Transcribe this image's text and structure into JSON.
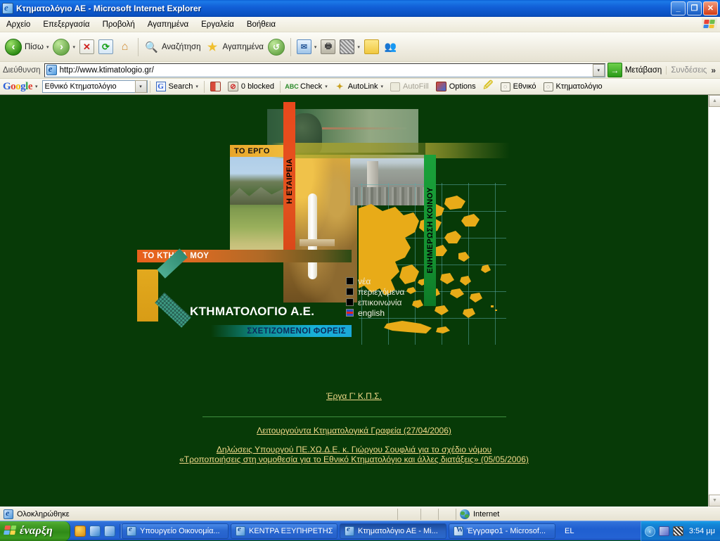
{
  "window": {
    "title": "Κτηματολόγιο ΑΕ - Microsoft Internet Explorer",
    "minimize_label": "_",
    "maximize_label": "❐",
    "close_label": "✕"
  },
  "menu": {
    "items": [
      {
        "label": "Αρχείο"
      },
      {
        "label": "Επεξεργασία"
      },
      {
        "label": "Προβολή"
      },
      {
        "label": "Αγαπημένα"
      },
      {
        "label": "Εργαλεία"
      },
      {
        "label": "Βοήθεια"
      }
    ]
  },
  "toolbar": {
    "back_label": "Πίσω",
    "forward_label": "",
    "stop_label": "",
    "refresh_label": "",
    "home_label": "",
    "search_label": "Αναζήτηση",
    "favorites_label": "Αγαπημένα",
    "history_label": "",
    "mail_label": "",
    "print_label": "",
    "edit_label": "",
    "notes_label": "",
    "messenger_label": "",
    "caret": "▾"
  },
  "address": {
    "label": "Διεύθυνση",
    "url": "http://www.ktimatologio.gr/",
    "go_label": "Μετάβαση",
    "links_label": "Συνδέσεις",
    "chevron": "»",
    "dropdown_caret": "▾"
  },
  "google_toolbar": {
    "logo": {
      "g1": "G",
      "o1": "o",
      "o2": "o",
      "g2": "g",
      "l": "l",
      "e": "e"
    },
    "query": "Εθνικό Κτηματολόγιο",
    "search_label": "Search",
    "blocked_label": "0 blocked",
    "check_label": "Check",
    "autolink_label": "AutoLink",
    "autofill_label": "AutoFill",
    "options_label": "Options",
    "highlight_label": "",
    "word1_label": "Εθνικό",
    "word2_label": "Κτηματολόγιο",
    "caret": "▾",
    "g_mark": "G"
  },
  "page": {
    "banner": {
      "tab_ergo": "ΤΟ ΕΡΓΟ",
      "tab_etairia": "Η ΕΤΑΙΡΕΙΑ",
      "tab_koinou": "ΕΝΗΜΕΡΩΣΗ ΚΟΙΝΟΥ",
      "tab_ktima": "ΤΟ ΚΤΗΜΑ ΜΟΥ",
      "tab_foreis": "ΣΧΕΤΙΖΟΜΕΝΟΙ ΦΟΡΕΙΣ",
      "company_name": "ΚΤΗΜΑΤΟΛΟΓΙΟ Α.Ε.",
      "nav": [
        {
          "label": "νέα"
        },
        {
          "label": "περιεχόμενα"
        },
        {
          "label": "επικοινωνία"
        },
        {
          "label": "english"
        }
      ]
    },
    "links": {
      "main": "Έργα Γ' Κ.Π.Σ.",
      "offices": "Λειτουργούντα Κτηματολογικά Γραφεία (27/04/2006)",
      "statement_line1": "Δηλώσεις Υπουργού ΠΕ.ΧΩ.Δ.Ε. κ. Γιώργου Σουφλιά για το σχέδιο νόμου",
      "statement_line2": "«Τροποποιήσεις στη νομοθεσία για το Εθνικό Κτηματολόγιο και άλλες διατάξεις» (05/05/2006)"
    },
    "colors": {
      "background": "#073a07",
      "link": "#f2d98a",
      "gold": "#e2a91e",
      "teal": "#3f9e86",
      "red_tab": "#e8481c",
      "green_tab": "#1aa13a",
      "cyan_tab": "#18b0d8"
    }
  },
  "scrollbar": {
    "up_arrow": "▲",
    "down_arrow": "▼"
  },
  "status_bar": {
    "text": "Ολοκληρώθηκε",
    "zone": "Internet"
  },
  "taskbar": {
    "start_label": "έναρξη",
    "buttons": [
      {
        "label": "Υπουργείο Οικονομία...",
        "icon": "ie-icon"
      },
      {
        "label": "ΚΕΝΤΡΑ ΕΞΥΠΗΡΕΤΗΣ...",
        "icon": "ie-icon"
      },
      {
        "label": "Κτηματολόγιο ΑΕ - Mi...",
        "icon": "ie-icon"
      },
      {
        "label": "Έγγραφο1 - Microsof...",
        "icon": "word-icon"
      }
    ],
    "language": "EL",
    "clock": "3:54 μμ",
    "tray_chevron": "‹"
  }
}
